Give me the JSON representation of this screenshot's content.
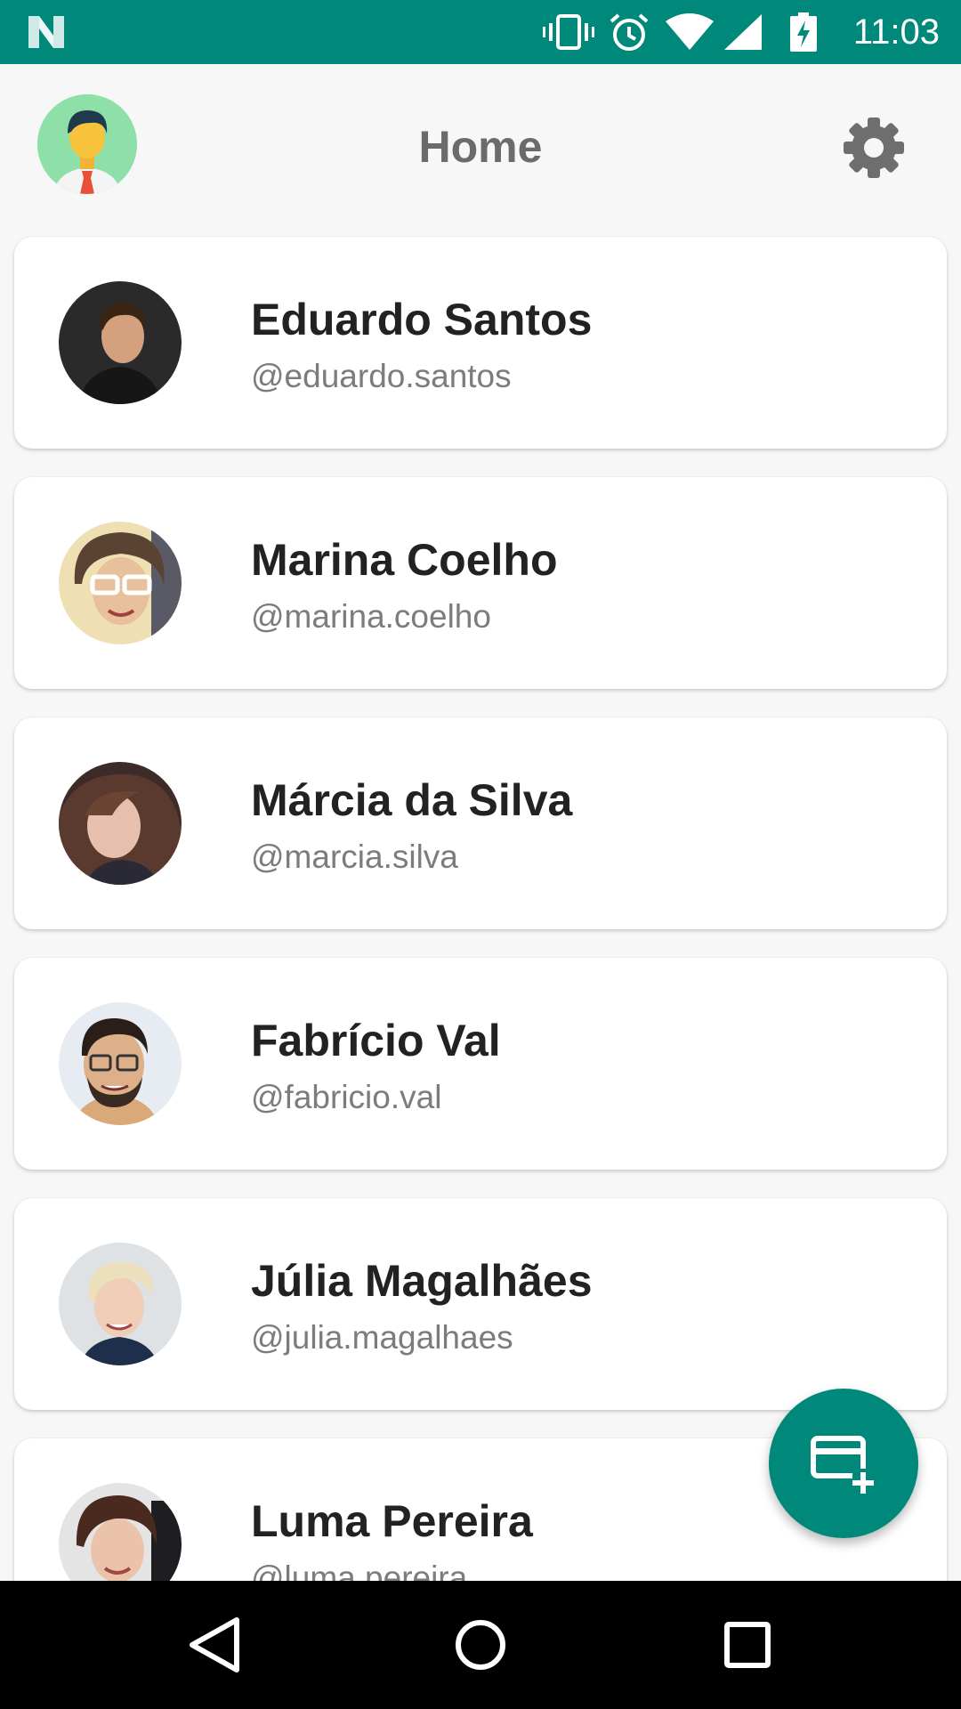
{
  "status_bar": {
    "time": "11:03",
    "icons": [
      "n-logo-icon",
      "vibrate-icon",
      "alarm-icon",
      "wifi-icon",
      "signal-icon",
      "battery-charging-icon"
    ],
    "background_color": "#00897b"
  },
  "header": {
    "title": "Home",
    "profile_avatar_icon": "user-avatar-icon",
    "settings_icon": "gear-icon"
  },
  "contacts": [
    {
      "name": "Eduardo Santos",
      "handle": "@eduardo.santos"
    },
    {
      "name": "Marina Coelho",
      "handle": "@marina.coelho"
    },
    {
      "name": "Márcia da Silva",
      "handle": "@marcia.silva"
    },
    {
      "name": "Fabrício Val",
      "handle": "@fabricio.val"
    },
    {
      "name": "Júlia Magalhães",
      "handle": "@julia.magalhaes"
    },
    {
      "name": "Luma Pereira",
      "handle": "@luma.pereira"
    }
  ],
  "fab": {
    "icon": "add-card-icon",
    "color": "#00897b"
  },
  "nav_bar": {
    "icons": [
      "back-icon",
      "home-icon",
      "recents-icon"
    ]
  }
}
